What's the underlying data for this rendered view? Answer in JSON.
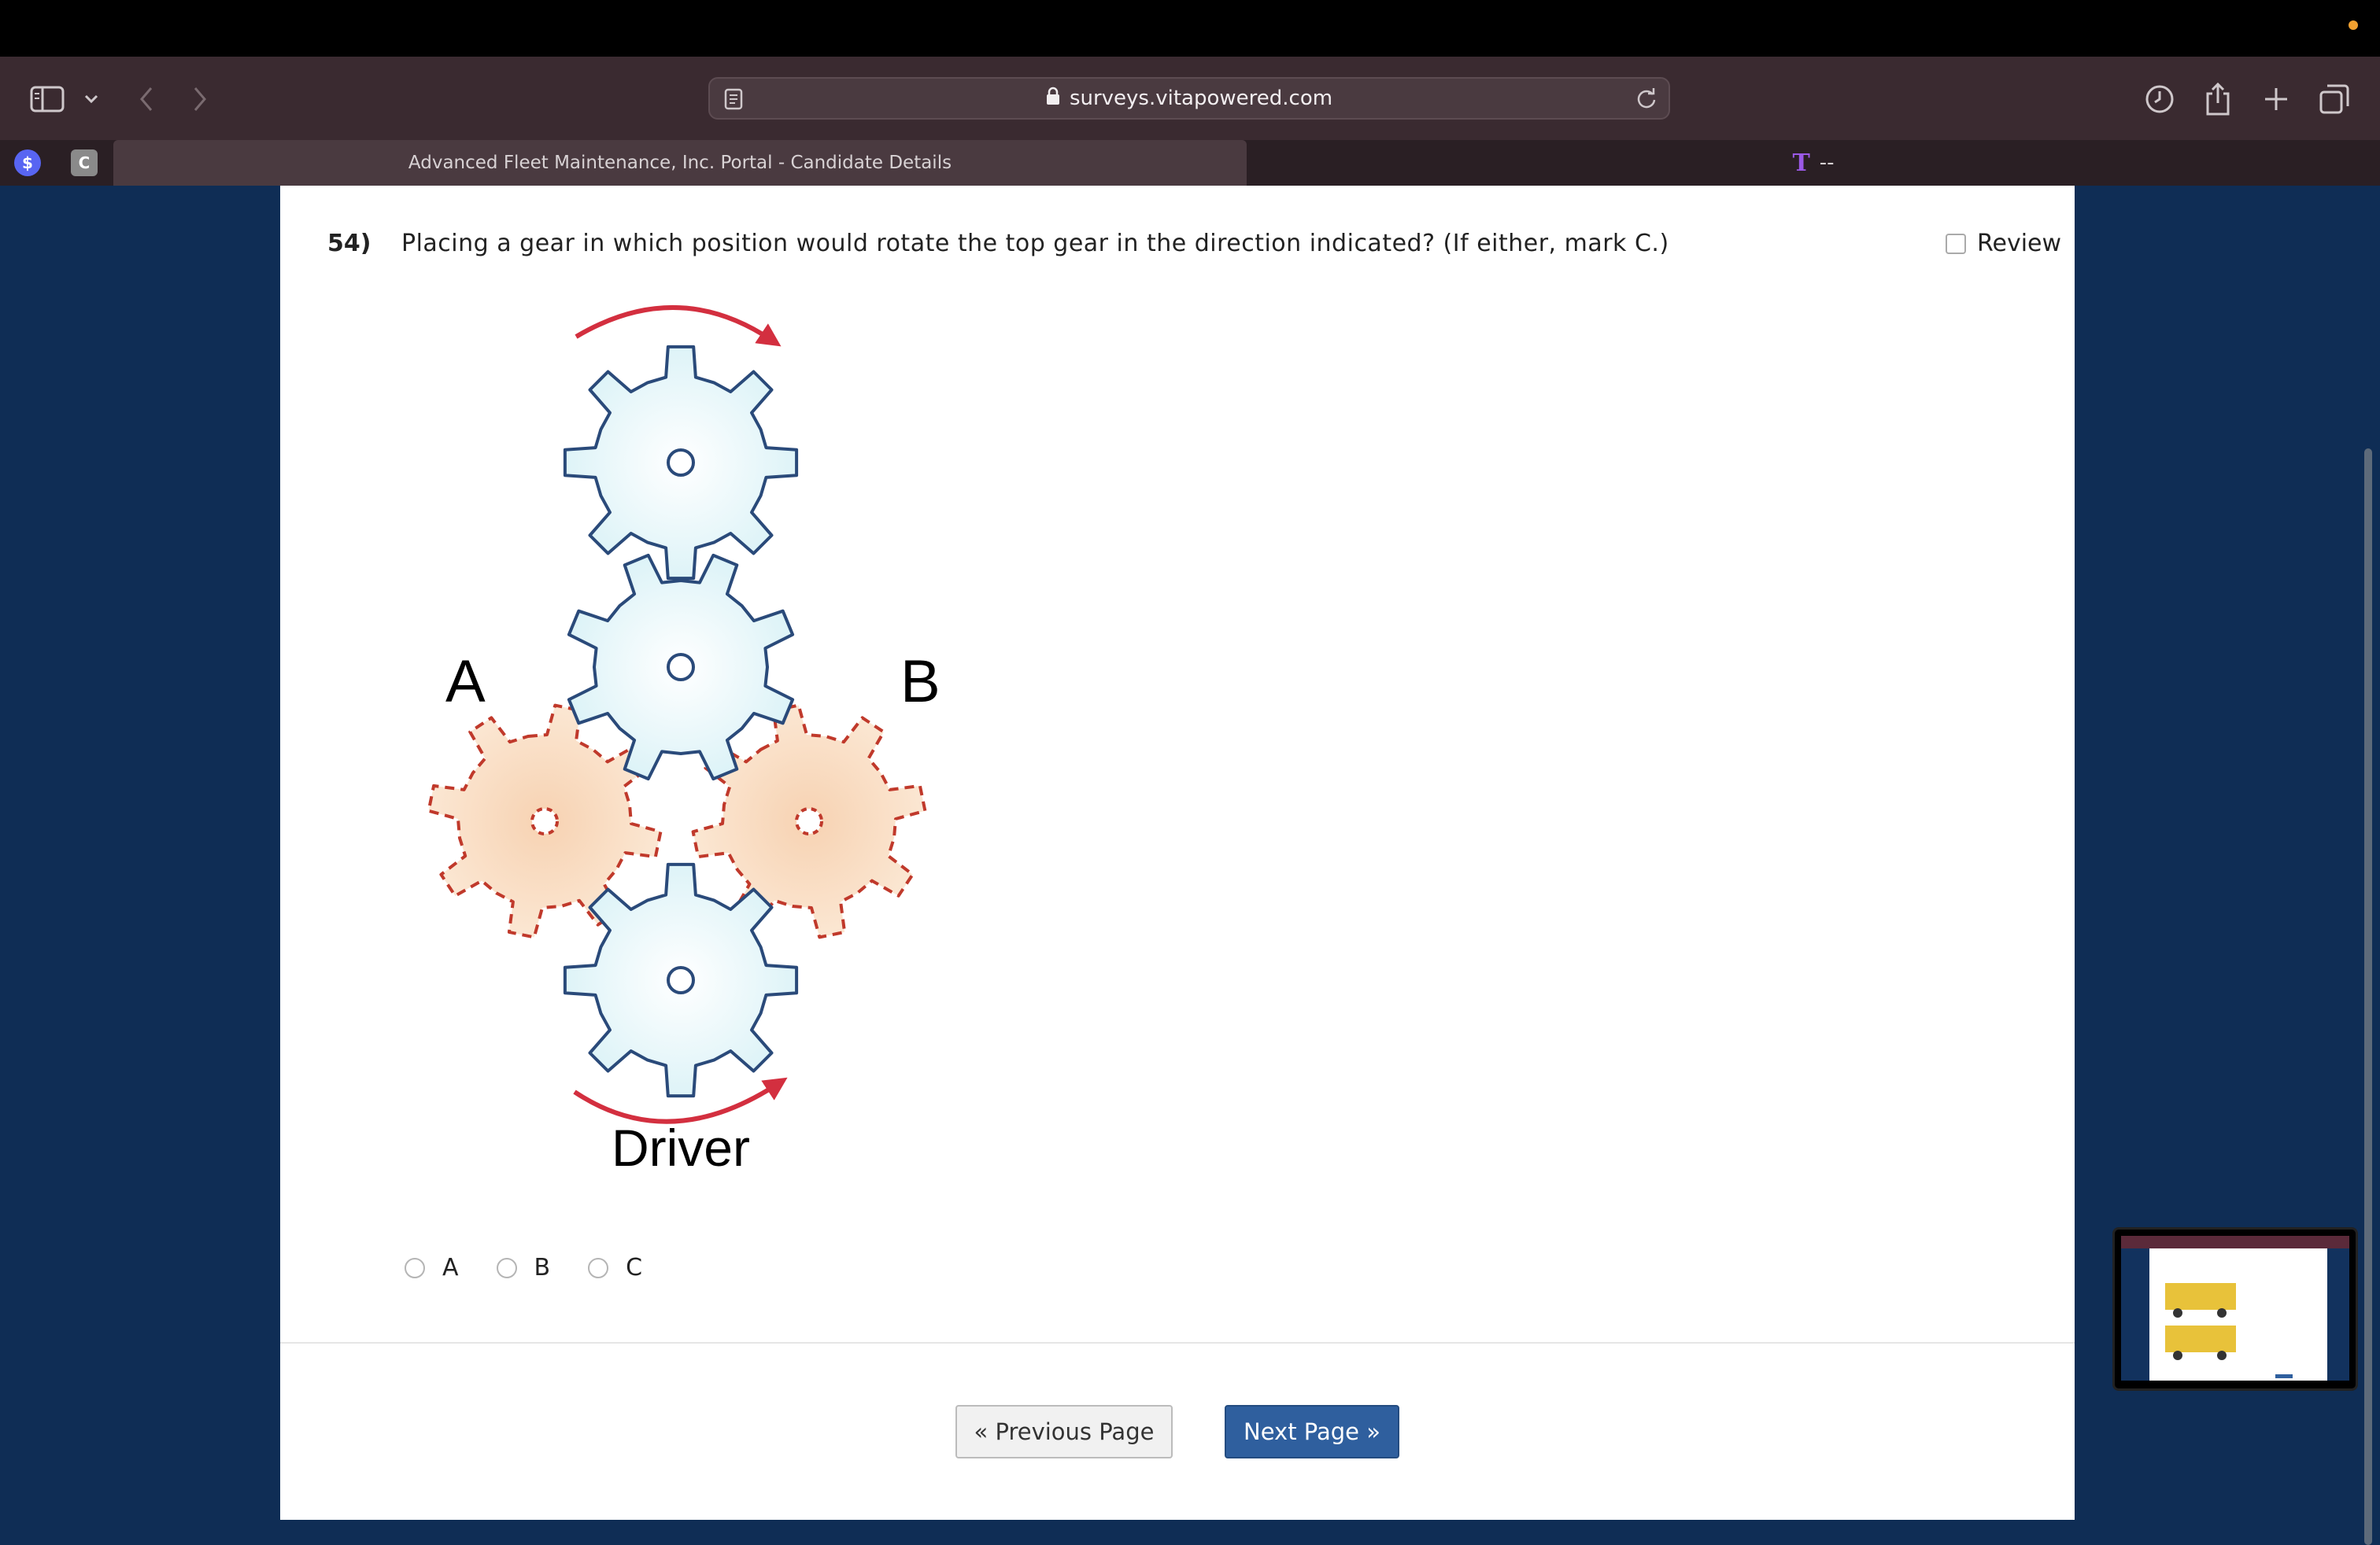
{
  "browser": {
    "url_domain": "surveys.vitapowered.com",
    "tabs": [
      {
        "title": "Advanced Fleet Maintenance, Inc. Portal - Candidate Details"
      },
      {
        "title": "--"
      }
    ],
    "favicons": [
      {
        "symbol": "$",
        "color": "#5865f2"
      },
      {
        "symbol": "C",
        "color": "#8a8a8a"
      }
    ]
  },
  "question": {
    "number": "54)",
    "text": "Placing a gear in which position would rotate the top gear in the direction indicated? (If either, mark C.)",
    "review_label": "Review"
  },
  "figure": {
    "label_a": "A",
    "label_b": "B",
    "driver_label": "Driver",
    "gear_color": "#eaf8fb",
    "gear_stroke": "#2a4a7a",
    "option_gear_color": "#f8dcc0",
    "option_gear_stroke": "#c0392b",
    "arrow_color": "#d32f3f"
  },
  "answers": [
    {
      "label": "A"
    },
    {
      "label": "B"
    },
    {
      "label": "C"
    }
  ],
  "navigation": {
    "previous_label": "« Previous Page",
    "next_label": "Next Page »"
  }
}
